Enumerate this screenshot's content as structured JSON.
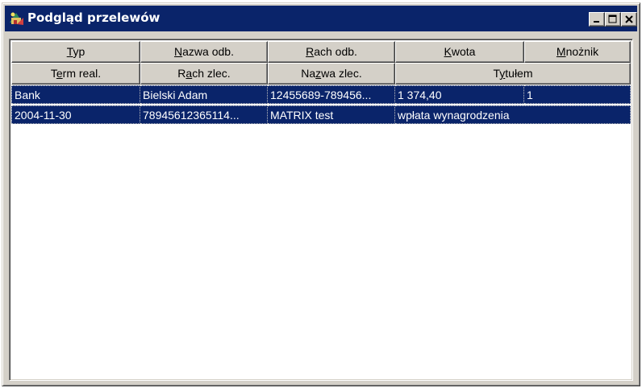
{
  "window": {
    "title": "Podgląd przelewów",
    "icon": "app-icon",
    "controls": [
      "minimize-icon",
      "maximize-icon",
      "close-icon"
    ]
  },
  "header_row1": [
    {
      "pre": "",
      "key": "T",
      "post": "yp"
    },
    {
      "pre": "",
      "key": "N",
      "post": "azwa odb."
    },
    {
      "pre": "",
      "key": "R",
      "post": "ach odb."
    },
    {
      "pre": "",
      "key": "K",
      "post": "wota"
    },
    {
      "pre": "",
      "key": "M",
      "post": "nożnik"
    }
  ],
  "header_row2": [
    {
      "pre": "T",
      "key": "e",
      "post": "rm real."
    },
    {
      "pre": "R",
      "key": "a",
      "post": "ch zlec."
    },
    {
      "pre": "Na",
      "key": "z",
      "post": "wa zlec."
    },
    {
      "pre": "T",
      "key": "y",
      "post": "tułem"
    }
  ],
  "rows": [
    {
      "cells": [
        "Bank",
        "Bielski Adam",
        "12455689-789456...",
        "1 374,40",
        "1"
      ]
    },
    {
      "cells": [
        "2004-11-30",
        "78945612365114...",
        "MATRIX test",
        "wpłata wynagrodzenia"
      ]
    }
  ],
  "colors": {
    "title_bg": "#0a246a",
    "selection_bg": "#0a246a",
    "face": "#d4d0c8"
  }
}
